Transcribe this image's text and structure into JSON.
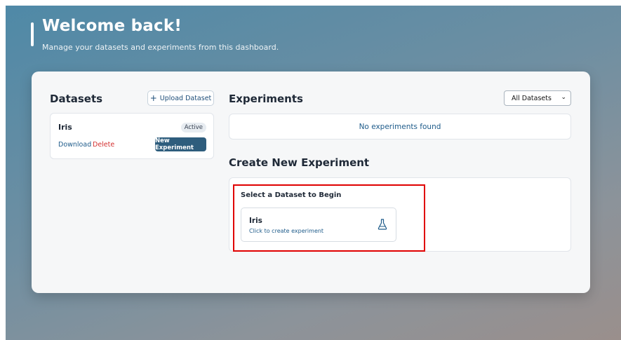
{
  "header": {
    "title": "Welcome back!",
    "subtitle": "Manage your datasets and experiments from this dashboard."
  },
  "datasets": {
    "heading": "Datasets",
    "upload_label": "Upload Dataset",
    "upload_icon": "plus-icon",
    "items": [
      {
        "name": "Iris",
        "status": "Active",
        "download_label": "Download",
        "delete_label": "Delete",
        "new_experiment_label": "New Experiment"
      }
    ]
  },
  "experiments": {
    "heading": "Experiments",
    "filter_selected": "All Datasets",
    "empty_text": "No experiments found"
  },
  "create": {
    "heading": "Create New Experiment",
    "select_title": "Select a Dataset to Begin",
    "card_name": "Iris",
    "card_subtitle": "Click to create experiment",
    "card_icon": "flask-icon"
  },
  "colors": {
    "accent": "#2e5d7d",
    "link": "#1e5b8a",
    "danger": "#d32f2f",
    "highlight": "#e00000"
  }
}
